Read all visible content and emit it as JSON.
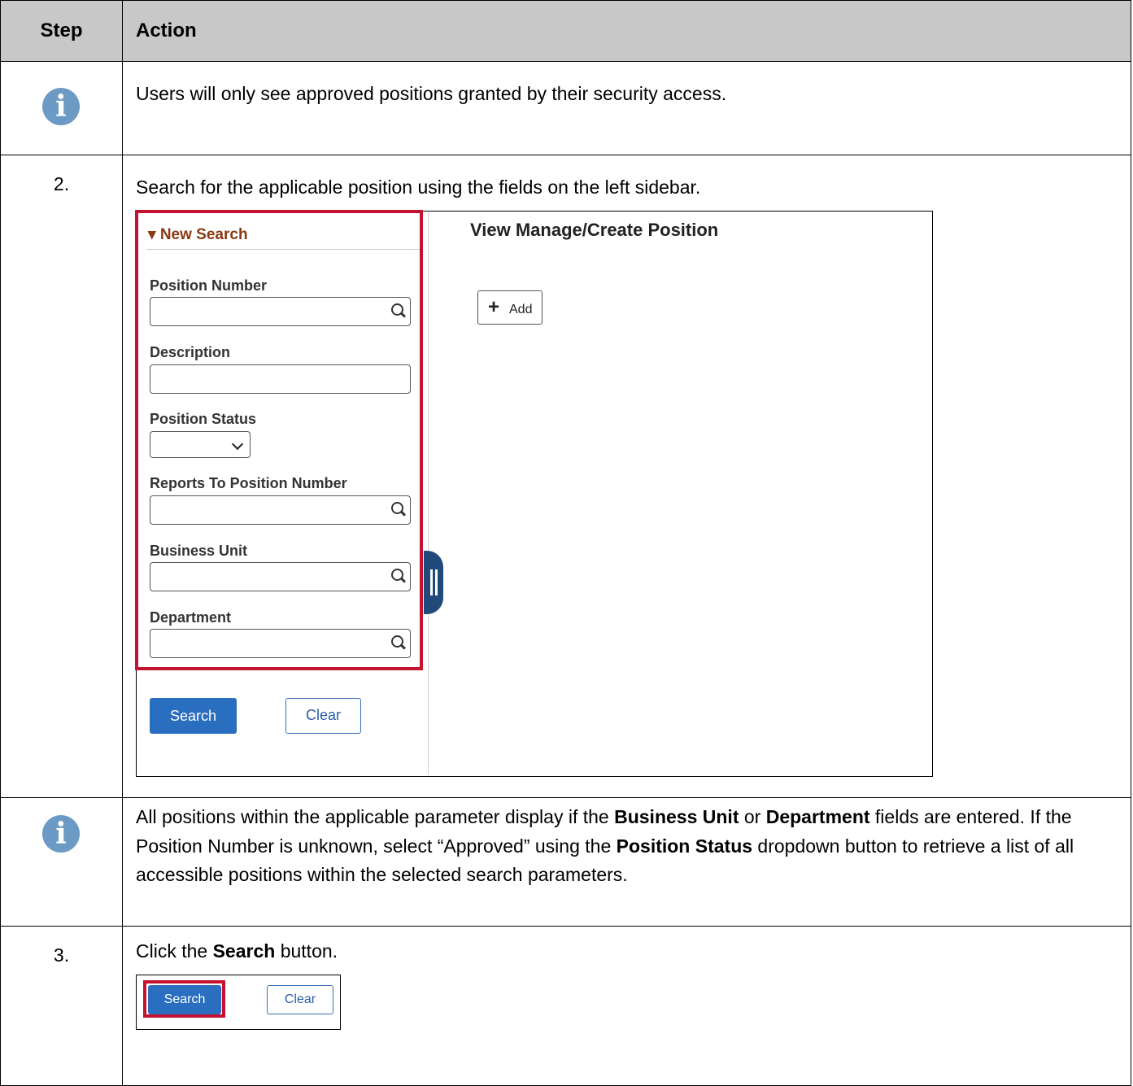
{
  "header": {
    "step": "Step",
    "action": "Action"
  },
  "rows": {
    "info1": {
      "text": "Users will only see approved positions granted by their security access."
    },
    "step2": {
      "num": "2.",
      "text": "Search for the applicable position using the fields on the left sidebar.",
      "screenshot": {
        "sidebar_title": "New Search",
        "fields": {
          "position_number": "Position Number",
          "description": "Description",
          "position_status": "Position Status",
          "reports_to": "Reports To Position Number",
          "business_unit": "Business Unit",
          "department": "Department"
        },
        "search_button": "Search",
        "clear_button": "Clear",
        "main_title": "View Manage/Create Position",
        "add_button": "Add",
        "highlight_color": "#c41230"
      }
    },
    "info2": {
      "t1": "All positions within the applicable parameter display if the ",
      "b1": "Business Unit",
      "t2": " or ",
      "b2": "Department",
      "t3": " fields are entered. If the Position Number is unknown, select “Approved” using the ",
      "b3": "Position Status",
      "t4": " dropdown button to retrieve a list of all accessible positions within the selected search parameters."
    },
    "step3": {
      "num": "3.",
      "t1": "Click the ",
      "b1": "Search",
      "t2": " button.",
      "search_button": "Search",
      "clear_button": "Clear"
    }
  },
  "colors": {
    "header_bg": "#c8c8c8",
    "info_icon": "#6b9ac4",
    "button_blue": "#2a6ebf"
  }
}
